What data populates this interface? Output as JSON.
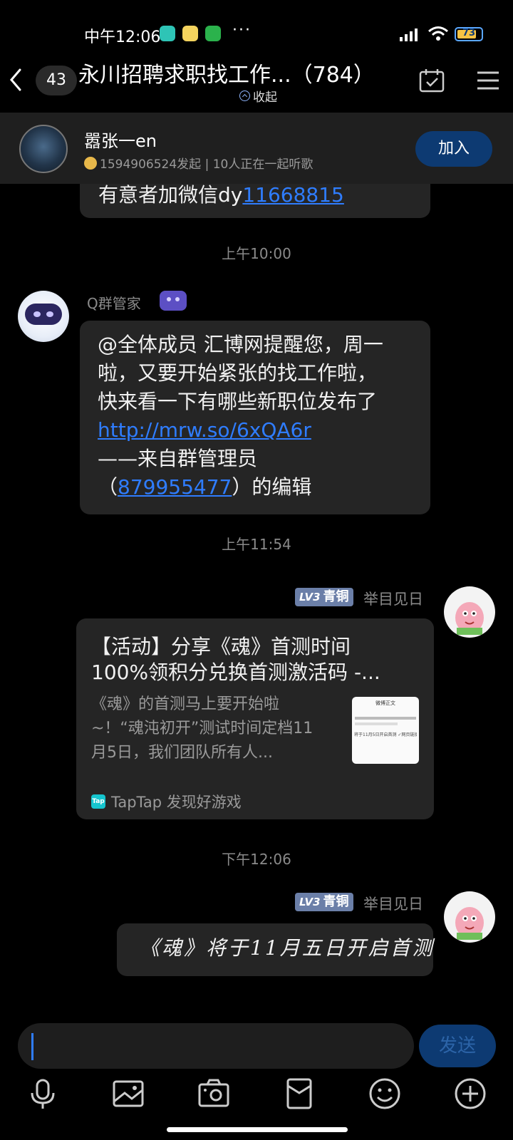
{
  "status_bar": {
    "time": "中午12:06",
    "dots": "···",
    "battery": "73"
  },
  "header": {
    "unread_count": "43",
    "title": "永川招聘求职找工作...（784）",
    "collapse_label": "收起"
  },
  "listen_banner": {
    "name": "嚣张一en",
    "subtitle": "1594906524发起 | 10人正在一起听歌",
    "join_label": "加入"
  },
  "messages": [
    {
      "text_prefix": "有意者加微信dy",
      "link": "11668815"
    },
    {
      "time": "上午10:00"
    },
    {
      "sender": "Q群管家",
      "line1": "@全体成员 汇博网提醒您，周一",
      "line2": "啦，又要开始紧张的找工作啦，",
      "line3": "快来看一下有哪些新职位发布了",
      "url": "http://mrw.so/6xQA6r",
      "line5": "——来自群管理员",
      "paren_open": "（",
      "admin_id": "879955477",
      "line6_suffix": "）的编辑"
    },
    {
      "time": "上午11:54"
    },
    {
      "sender": "举目见日",
      "level": "LV3",
      "rank": "青铜",
      "card_title": "【活动】分享《魂》首测时间100%领积分兑换首测激活码 -...",
      "card_desc": "《魂》的首测马上要开始啦~！“魂沌初开”测试时间定档11月5日，我们团队所有人...",
      "card_source": "TapTap 发现好游戏",
      "thumb_header": "微博正文",
      "thumb_text": "将于11月5日开启首测 ✓网页链接"
    },
    {
      "time": "下午12:06"
    },
    {
      "sender": "举目见日",
      "level": "LV3",
      "rank": "青铜",
      "text": "《魂》将于11月五日开启首测"
    }
  ],
  "input": {
    "placeholder": "",
    "send_label": "发送"
  },
  "toolbar": {
    "icons": [
      "microphone-icon",
      "image-icon",
      "camera-icon",
      "red-packet-icon",
      "emoji-icon",
      "plus-icon"
    ]
  },
  "colors": {
    "link": "#2f7dff",
    "join": "#0d3a72",
    "bubble": "#252525"
  }
}
